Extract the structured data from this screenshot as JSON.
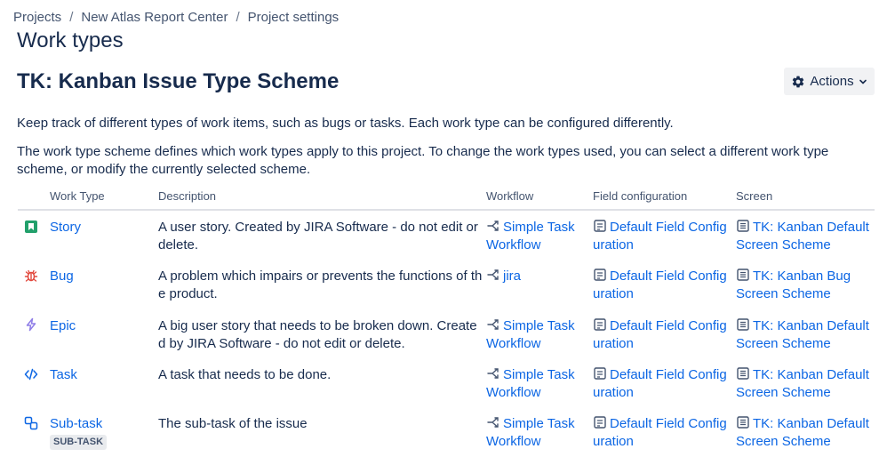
{
  "breadcrumb": {
    "items": [
      "Projects",
      "New Atlas Report Center",
      "Project settings"
    ],
    "separator": "/"
  },
  "page_title": "Work types",
  "scheme_title": "TK: Kanban Issue Type Scheme",
  "actions_label": "Actions",
  "description_1": "Keep track of different types of work items, such as bugs or tasks. Each work type can be configured differently.",
  "description_2": "The work type scheme defines which work types apply to this project. To change the work types used, you can select a different work type scheme, or modify the currently selected scheme.",
  "table": {
    "headers": {
      "work_type": "Work Type",
      "description": "Description",
      "workflow": "Workflow",
      "field_configuration": "Field configuration",
      "screen": "Screen"
    },
    "rows": [
      {
        "name": "Story",
        "icon": "story-icon",
        "description": "A user story. Created by JIRA Software - do not edit or delete.",
        "workflow": "Simple Task Workflow",
        "field_config": "Default Field Configuration",
        "screen": "TK: Kanban Default Screen Scheme"
      },
      {
        "name": "Bug",
        "icon": "bug-icon",
        "description": "A problem which impairs or prevents the functions of the product.",
        "workflow": "jira",
        "field_config": "Default Field Configuration",
        "screen": "TK: Kanban Bug Screen Scheme"
      },
      {
        "name": "Epic",
        "icon": "epic-icon",
        "description": "A big user story that needs to be broken down. Created by JIRA Software - do not edit or delete.",
        "workflow": "Simple Task Workflow",
        "field_config": "Default Field Configuration",
        "screen": "TK: Kanban Default Screen Scheme"
      },
      {
        "name": "Task",
        "icon": "task-icon",
        "description": "A task that needs to be done.",
        "workflow": "Simple Task Workflow",
        "field_config": "Default Field Configuration",
        "screen": "TK: Kanban Default Screen Scheme"
      },
      {
        "name": "Sub-task",
        "icon": "subtask-icon",
        "badge": "SUB-TASK",
        "description": "The sub-task of the issue",
        "workflow": "Simple Task Workflow",
        "field_config": "Default Field Configuration",
        "screen": "TK: Kanban Default Screen Scheme"
      }
    ]
  },
  "colors": {
    "link": "#0c66e4",
    "story": "#22a06b",
    "bug": "#e2483d",
    "epic": "#8f7ee7",
    "task": "#0c66e4",
    "subtask": "#0c66e4"
  }
}
